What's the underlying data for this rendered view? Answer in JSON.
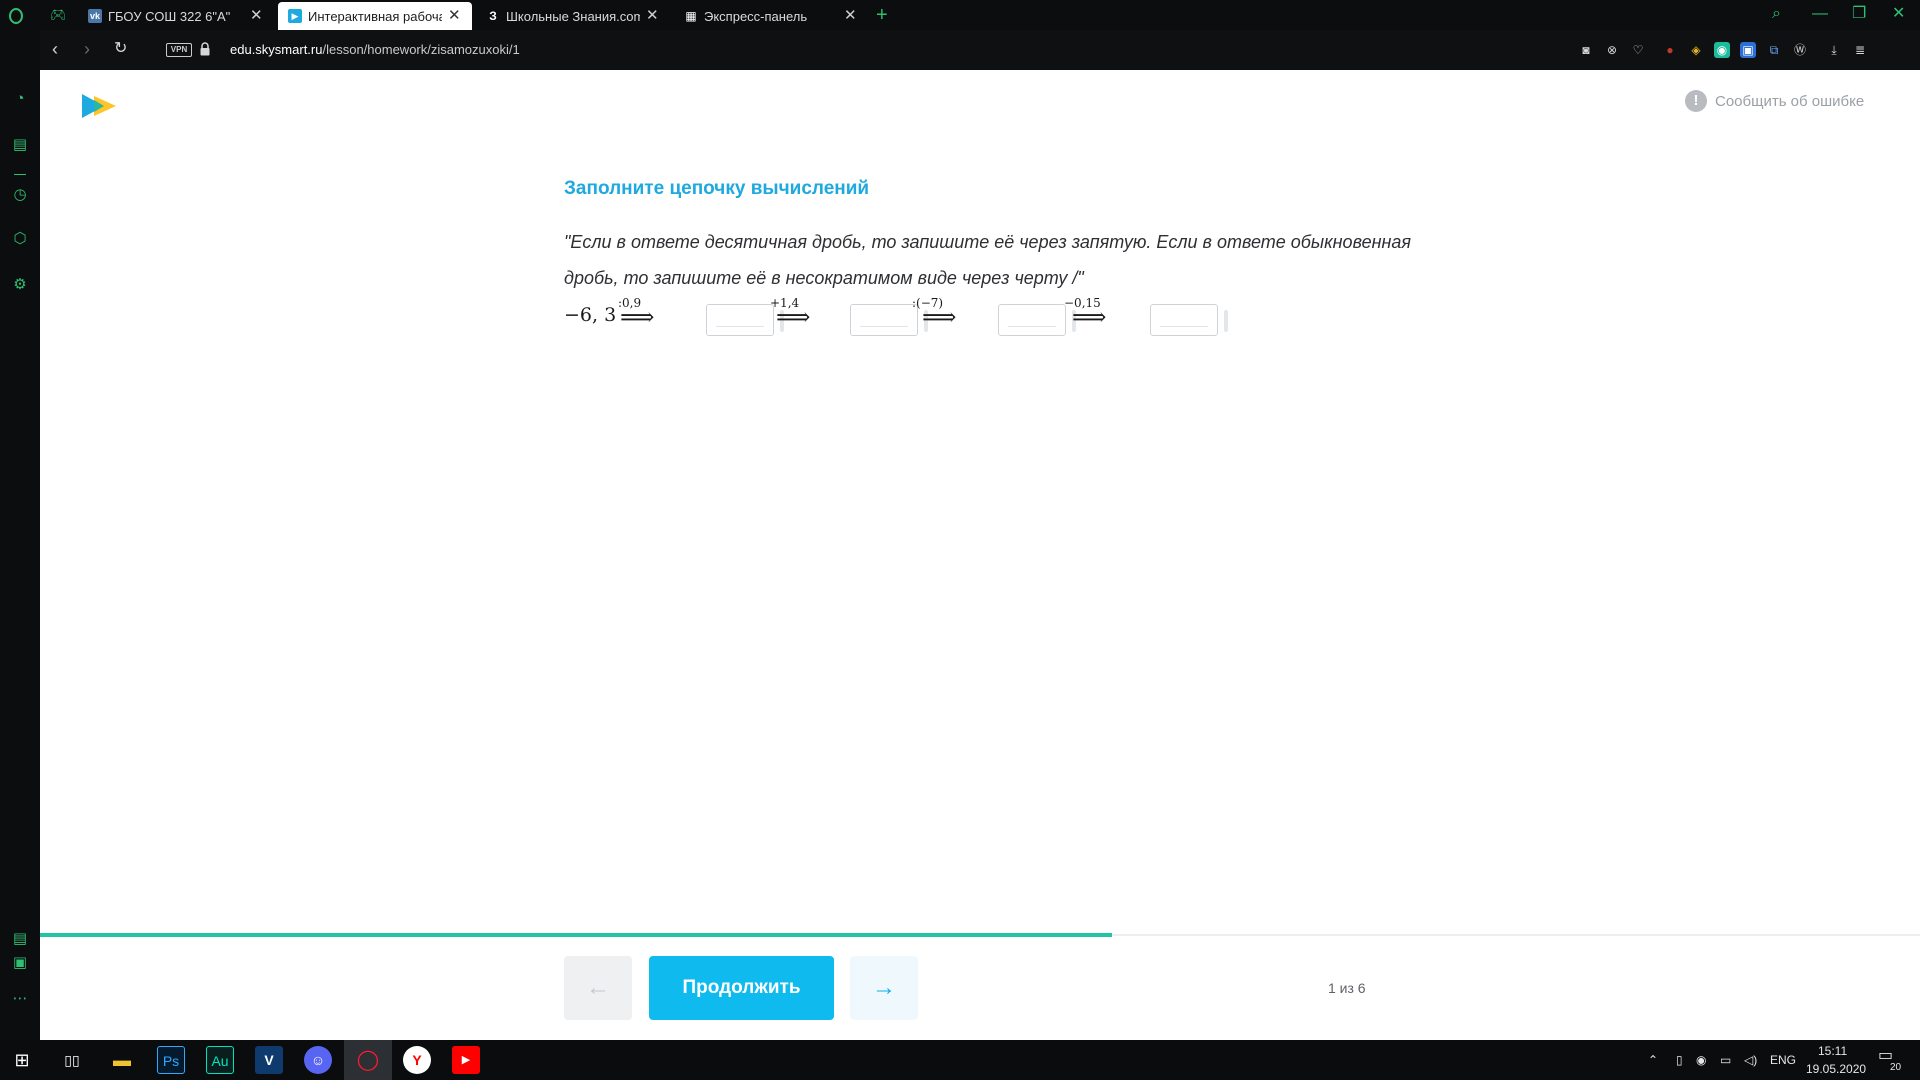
{
  "browser": {
    "tabs": [
      {
        "label": "ГБОУ СОШ 322 6\"А\"",
        "favicon": "vk-icon",
        "favicon_color": "#4a76a8",
        "active": false
      },
      {
        "label": "Интерактивная рабочая т",
        "favicon": "skysmart-icon",
        "favicon_color": "#1ea9df",
        "active": true
      },
      {
        "label": "Школьные Знания.com - Р",
        "favicon": "znanija-icon",
        "favicon_color": "#0c0d0f",
        "active": false
      },
      {
        "label": "Экспресс-панель",
        "favicon": "speed-dial-icon",
        "favicon_color": "#0c0d0f",
        "active": false
      }
    ],
    "vpn_label": "VPN",
    "url_domain": "edu.skysmart.ru",
    "url_path": "/lesson/homework/zisamozuxoki/1",
    "accent_color": "#2fbf71"
  },
  "page": {
    "report_label": "Сообщить об ошибке",
    "task_title": "Заполните цепочку вычислений",
    "task_instructions": "\"Если в ответе десятичная дробь, то запишите её через запятую. Если в ответе обыкновенная дробь, то запишите её в несократимом виде через черту /\"",
    "chain": {
      "start": "−6, 3",
      "steps": [
        {
          "op": ":0,9",
          "answer": ""
        },
        {
          "op": "+1,4",
          "answer": ""
        },
        {
          "op": ":(−7)",
          "answer": ""
        },
        {
          "op": "−0,15",
          "answer": ""
        }
      ]
    },
    "progress_fraction": 0.57,
    "continue_label": "Продолжить",
    "prev_arrow": "←",
    "next_arrow": "→",
    "page_counter": "1 из 6",
    "title_color": "#1ea9df",
    "button_color": "#0fbaee"
  },
  "taskbar": {
    "apps": [
      "windows-start-icon",
      "task-view-icon",
      "file-explorer-icon",
      "photoshop-icon",
      "audition-icon",
      "vegas-icon",
      "discord-icon",
      "opera-icon",
      "yandex-icon",
      "youtube-icon"
    ],
    "photoshop_label": "Ps",
    "audition_label": "Au",
    "vegas_label": "V",
    "language": "ENG",
    "time": "15:11",
    "date": "19.05.2020",
    "notifications": "20"
  }
}
